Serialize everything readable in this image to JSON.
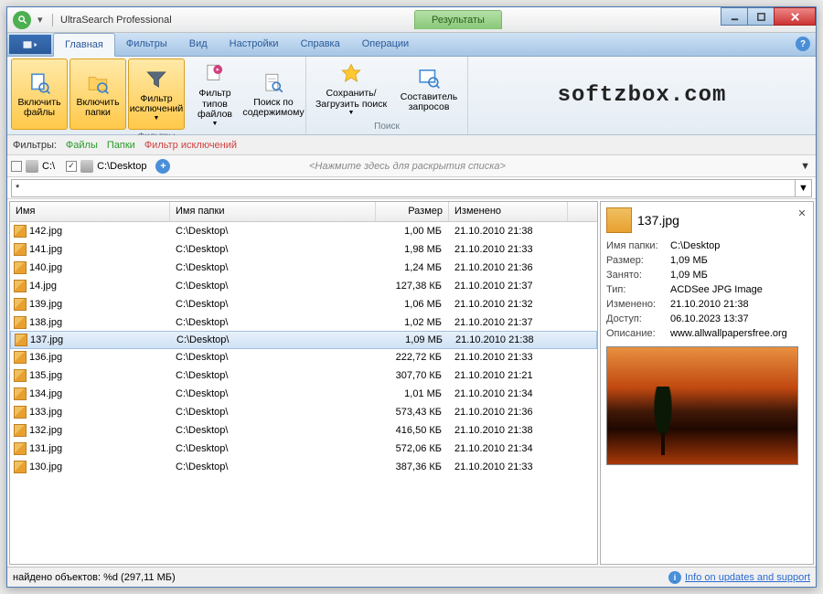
{
  "window": {
    "title": "UltraSearch Professional",
    "results_tab": "Результаты"
  },
  "menu": {
    "tabs": [
      "Главная",
      "Фильтры",
      "Вид",
      "Настройки",
      "Справка",
      "Операции"
    ],
    "active_index": 0
  },
  "ribbon": {
    "group_filters_label": "Фильтры",
    "group_search_label": "Поиск",
    "btn_include_files": "Включить файлы",
    "btn_include_folders": "Включить папки",
    "btn_exclude_filter": "Фильтр исключений",
    "btn_filetype_filter": "Фильтр типов файлов",
    "btn_content_search": "Поиск по содержимому",
    "btn_save_load": "Сохранить/ Загрузить поиск",
    "btn_query_builder": "Составитель запросов",
    "logo_text": "softzbox.com"
  },
  "filterbar": {
    "label": "Фильтры:",
    "files": "Файлы",
    "folders": "Папки",
    "exclude": "Фильтр исключений"
  },
  "pathbar": {
    "drive1": "C:\\",
    "drive2": "C:\\Desktop",
    "hint": "<Нажмите здесь для раскрытия списка>"
  },
  "search": {
    "value": "*"
  },
  "columns": {
    "name": "Имя",
    "folder": "Имя папки",
    "size": "Размер",
    "modified": "Изменено"
  },
  "rows": [
    {
      "name": "142.jpg",
      "folder": "C:\\Desktop\\",
      "size": "1,00 МБ",
      "mod": "21.10.2010 21:38"
    },
    {
      "name": "141.jpg",
      "folder": "C:\\Desktop\\",
      "size": "1,98 МБ",
      "mod": "21.10.2010 21:33"
    },
    {
      "name": "140.jpg",
      "folder": "C:\\Desktop\\",
      "size": "1,24 МБ",
      "mod": "21.10.2010 21:36"
    },
    {
      "name": "14.jpg",
      "folder": "C:\\Desktop\\",
      "size": "127,38 КБ",
      "mod": "21.10.2010 21:37"
    },
    {
      "name": "139.jpg",
      "folder": "C:\\Desktop\\",
      "size": "1,06 МБ",
      "mod": "21.10.2010 21:32"
    },
    {
      "name": "138.jpg",
      "folder": "C:\\Desktop\\",
      "size": "1,02 МБ",
      "mod": "21.10.2010 21:37"
    },
    {
      "name": "137.jpg",
      "folder": "C:\\Desktop\\",
      "size": "1,09 МБ",
      "mod": "21.10.2010 21:38"
    },
    {
      "name": "136.jpg",
      "folder": "C:\\Desktop\\",
      "size": "222,72 КБ",
      "mod": "21.10.2010 21:33"
    },
    {
      "name": "135.jpg",
      "folder": "C:\\Desktop\\",
      "size": "307,70 КБ",
      "mod": "21.10.2010 21:21"
    },
    {
      "name": "134.jpg",
      "folder": "C:\\Desktop\\",
      "size": "1,01 МБ",
      "mod": "21.10.2010 21:34"
    },
    {
      "name": "133.jpg",
      "folder": "C:\\Desktop\\",
      "size": "573,43 КБ",
      "mod": "21.10.2010 21:36"
    },
    {
      "name": "132.jpg",
      "folder": "C:\\Desktop\\",
      "size": "416,50 КБ",
      "mod": "21.10.2010 21:38"
    },
    {
      "name": "131.jpg",
      "folder": "C:\\Desktop\\",
      "size": "572,06 КБ",
      "mod": "21.10.2010 21:34"
    },
    {
      "name": "130.jpg",
      "folder": "C:\\Desktop\\",
      "size": "387,36 КБ",
      "mod": "21.10.2010 21:33"
    }
  ],
  "selected_index": 6,
  "preview": {
    "filename": "137.jpg",
    "fields": {
      "folder_k": "Имя папки:",
      "folder_v": "C:\\Desktop",
      "size_k": "Размер:",
      "size_v": "1,09 МБ",
      "disk_k": "Занято:",
      "disk_v": "1,09 МБ",
      "type_k": "Тип:",
      "type_v": "ACDSee JPG Image",
      "mod_k": "Изменено:",
      "mod_v": "21.10.2010 21:38",
      "acc_k": "Доступ:",
      "acc_v": "06.10.2023 13:37",
      "desc_k": "Описание:",
      "desc_v": "www.allwallpapersfree.org"
    }
  },
  "status": {
    "found": "найдено объектов: %d (297,11 МБ)",
    "info_link": "Info on updates and support"
  }
}
